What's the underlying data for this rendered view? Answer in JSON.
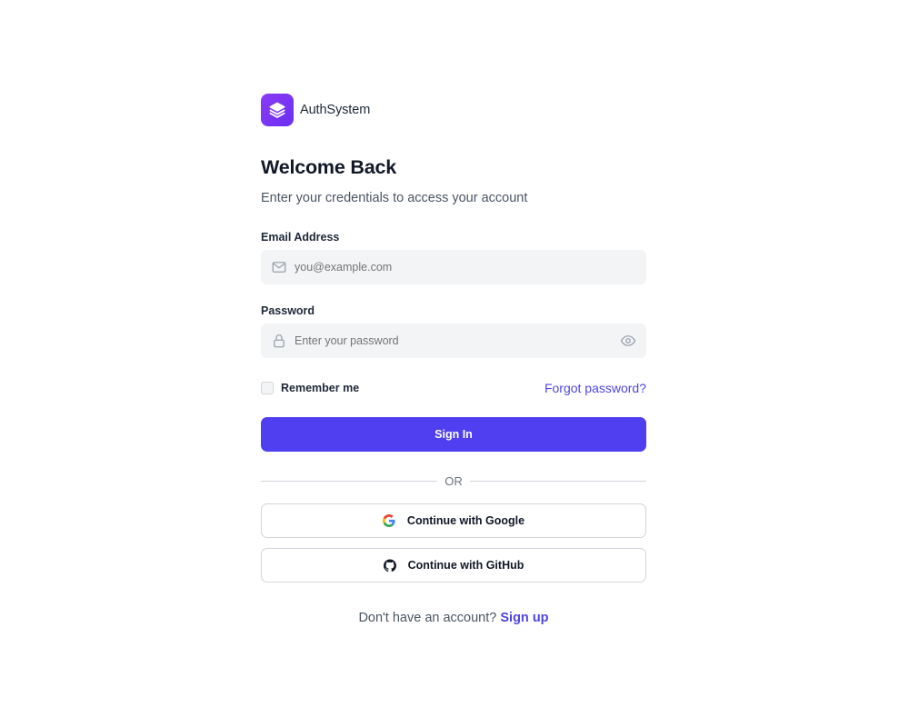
{
  "brand": {
    "name": "AuthSystem",
    "icon": "layers-icon",
    "color": "#7c3aed"
  },
  "header": {
    "title": "Welcome Back",
    "subtitle": "Enter your credentials to access your account"
  },
  "form": {
    "email": {
      "label": "Email Address",
      "placeholder": "you@example.com",
      "value": "",
      "icon": "mail-icon"
    },
    "password": {
      "label": "Password",
      "placeholder": "Enter your password",
      "value": "",
      "icon": "lock-icon",
      "toggle_icon": "eye-icon"
    },
    "remember_label": "Remember me",
    "remember_checked": false,
    "forgot_label": "Forgot password?",
    "submit_label": "Sign In"
  },
  "divider": {
    "label": "OR"
  },
  "social": {
    "google_label": "Continue with Google",
    "github_label": "Continue with GitHub"
  },
  "footer": {
    "prompt": "Don't have an account?",
    "link_label": "Sign up"
  },
  "colors": {
    "primary": "#4f3ff0",
    "link": "#4f46e5",
    "input_bg": "#f3f4f6"
  }
}
